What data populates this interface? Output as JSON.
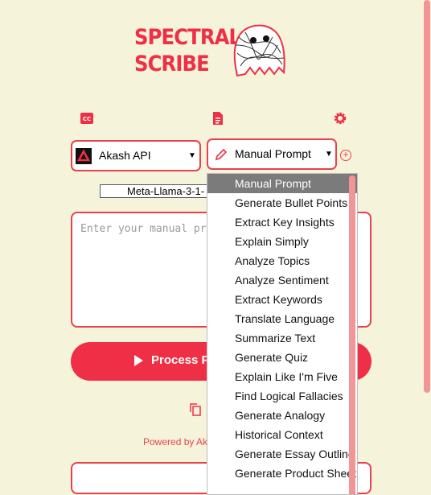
{
  "logo": {
    "line1": "SPECTRAL",
    "line2": "SCRIBE"
  },
  "api_select": {
    "value": "Akash API"
  },
  "prompt_select": {
    "value": "Manual Prompt"
  },
  "model": {
    "value": "Meta-Llama-3-1-"
  },
  "textarea": {
    "placeholder": "Enter your manual prompt"
  },
  "process_button": {
    "label": "Process Prompt"
  },
  "footer": {
    "powered": "Powered by Akash"
  },
  "dropdown": {
    "items": [
      "Manual Prompt",
      "Generate Bullet Points",
      "Extract Key Insights",
      "Explain Simply",
      "Analyze Topics",
      "Analyze Sentiment",
      "Extract Keywords",
      "Translate Language",
      "Summarize Text",
      "Generate Quiz",
      "Explain Like I'm Five",
      "Find Logical Fallacies",
      "Generate Analogy",
      "Historical Context",
      "Generate Essay Outline",
      "Generate Product Sheet"
    ]
  },
  "colors": {
    "accent": "#ef2f45",
    "background": "#f6f3db",
    "scrollbar": "#f39497",
    "selected": "#7b7b7b"
  }
}
